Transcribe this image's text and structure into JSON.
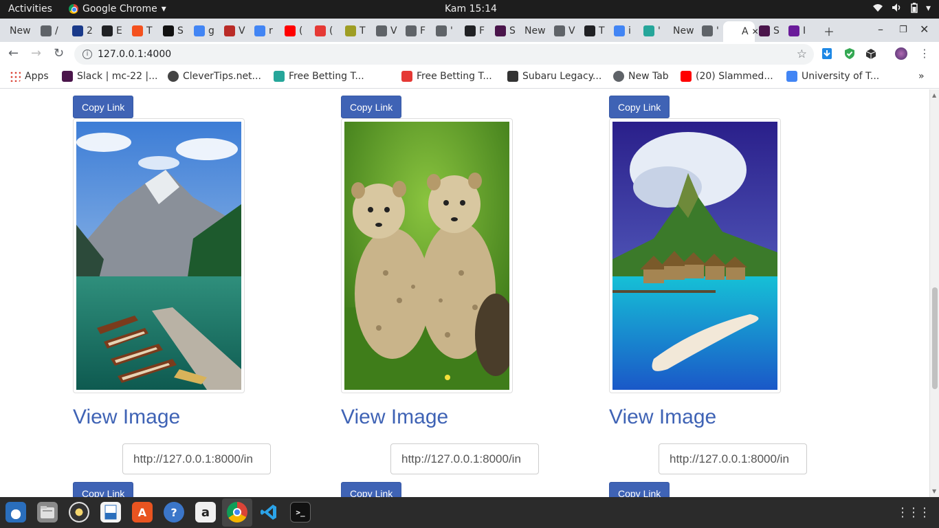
{
  "os_topbar": {
    "activities": "Activities",
    "app_name": "Google Chrome",
    "clock": "Kam 15:14"
  },
  "tabs": [
    {
      "label": "New",
      "color": "#ffffff"
    },
    {
      "label": "/",
      "color": "#5f6368"
    },
    {
      "label": "2",
      "color": "#1a3a8a"
    },
    {
      "label": "E",
      "color": "#202124"
    },
    {
      "label": "T",
      "color": "#f4511e"
    },
    {
      "label": "S",
      "color": "#111111"
    },
    {
      "label": "g",
      "color": "#4285f4"
    },
    {
      "label": "V",
      "color": "#b92b27"
    },
    {
      "label": "r",
      "color": "#4285f4"
    },
    {
      "label": "(",
      "color": "#ff0000"
    },
    {
      "label": "(",
      "color": "#e53935"
    },
    {
      "label": "T",
      "color": "#9e9d24"
    },
    {
      "label": "V",
      "color": "#5f6368"
    },
    {
      "label": "F",
      "color": "#5f6368"
    },
    {
      "label": "'",
      "color": "#5f6368"
    },
    {
      "label": "F",
      "color": "#202124"
    },
    {
      "label": "S",
      "color": "#4a154b"
    },
    {
      "label": "New",
      "color": "#ffffff"
    },
    {
      "label": "V",
      "color": "#5f6368"
    },
    {
      "label": "T",
      "color": "#202124"
    },
    {
      "label": "i",
      "color": "#4285f4"
    },
    {
      "label": "'",
      "color": "#26a69a"
    },
    {
      "label": "New",
      "color": "#ffffff"
    },
    {
      "label": "'",
      "color": "#5f6368"
    },
    {
      "label": "A",
      "color": "#ffffff"
    },
    {
      "label": "S",
      "color": "#4a154b"
    },
    {
      "label": "I",
      "color": "#6a1b9a"
    }
  ],
  "address_bar": {
    "url": "127.0.0.1:4000"
  },
  "bookmarks": [
    {
      "label": "Apps",
      "color": "#4285f4"
    },
    {
      "label": "Slack | mc-22 |...",
      "color": "#4a154b"
    },
    {
      "label": "CleverTips.net...",
      "color": "#444444"
    },
    {
      "label": "Free Betting T...",
      "color": "#26a69a"
    },
    {
      "label": "Free Betting T...",
      "color": "#e53935"
    },
    {
      "label": "Subaru Legacy...",
      "color": "#333333"
    },
    {
      "label": "New Tab",
      "color": "#5f6368"
    },
    {
      "label": "(20) Slammed...",
      "color": "#ff0000"
    },
    {
      "label": "University of T...",
      "color": "#4285f4"
    }
  ],
  "cards": [
    {
      "copy_label": "Copy Link",
      "view_label": "View Image",
      "url_value": "http://127.0.0.1:8000/in",
      "image": "mountain-lake-boats"
    },
    {
      "copy_label": "Copy Link",
      "view_label": "View Image",
      "url_value": "http://127.0.0.1:8000/in",
      "image": "cheetah-cubs"
    },
    {
      "copy_label": "Copy Link",
      "view_label": "View Image",
      "url_value": "http://127.0.0.1:8000/in",
      "image": "tropical-island-bungalows"
    }
  ],
  "next_row": {
    "copy_label": "Copy Link"
  },
  "colors": {
    "primary": "#3f63b5",
    "dock_bg": "#2b2b2b",
    "topbar_bg": "#1d1d1d"
  }
}
